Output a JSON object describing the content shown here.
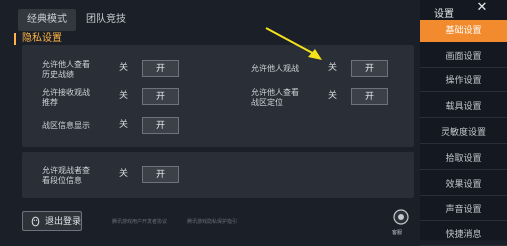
{
  "tabs": {
    "classic": "经典模式",
    "team": "团队竞技"
  },
  "section_title": "隐私设置",
  "options": {
    "view_history_line1": "允许他人查看",
    "view_history_line2": "历史战绩",
    "spectate": "允许他人观战",
    "receive_spectate_line1": "允许接收观战",
    "receive_spectate_line2": "推荐",
    "view_location_line1": "允许他人查看",
    "view_location_line2": "战区定位",
    "zone_info": "战区信息显示",
    "spectator_view_line1": "允许观战者查",
    "spectator_view_line2": "看段位信息"
  },
  "toggle": {
    "off": "关",
    "on": "开"
  },
  "logout_label": "退出登录",
  "footer_links": [
    "腾讯游戏用户开发者协议",
    "腾讯游戏隐私保护指引"
  ],
  "voice_label": "客服",
  "sidebar": {
    "title": "设置",
    "close": "✕",
    "items": [
      {
        "label": "基础设置",
        "active": true
      },
      {
        "label": "画面设置",
        "active": false
      },
      {
        "label": "操作设置",
        "active": false
      },
      {
        "label": "载具设置",
        "active": false
      },
      {
        "label": "灵敏度设置",
        "active": false
      },
      {
        "label": "拾取设置",
        "active": false
      },
      {
        "label": "效果设置",
        "active": false
      },
      {
        "label": "声音设置",
        "active": false
      },
      {
        "label": "快捷消息",
        "active": false
      }
    ]
  },
  "colors": {
    "accent": "#f28a2e",
    "section": "#ffb347",
    "arrow": "#f4e21b"
  }
}
